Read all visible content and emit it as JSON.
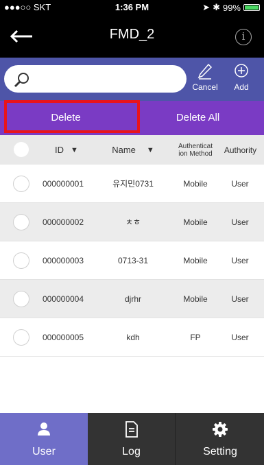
{
  "status_bar": {
    "carrier": "●●●○○ SKT",
    "time": "1:36 PM",
    "battery": "99%"
  },
  "navbar": {
    "title": "FMD_2"
  },
  "search": {
    "placeholder": "",
    "cancel_label": "Cancel",
    "add_label": "Add"
  },
  "actions": {
    "delete_label": "Delete",
    "delete_all_label": "Delete All"
  },
  "table": {
    "headers": {
      "id": "ID",
      "name": "Name",
      "auth_method": "Authenticat ion Method",
      "authority": "Authority"
    },
    "rows": [
      {
        "id": "000000001",
        "name": "유지민0731",
        "auth_method": "Mobile",
        "authority": "User"
      },
      {
        "id": "000000002",
        "name": "ㅊㅎ",
        "auth_method": "Mobile",
        "authority": "User"
      },
      {
        "id": "000000003",
        "name": "0713-31",
        "auth_method": "Mobile",
        "authority": "User"
      },
      {
        "id": "000000004",
        "name": "djrhr",
        "auth_method": "Mobile",
        "authority": "User"
      },
      {
        "id": "000000005",
        "name": "kdh",
        "auth_method": "FP",
        "authority": "User"
      }
    ]
  },
  "tabs": {
    "user_label": "User",
    "log_label": "Log",
    "setting_label": "Setting",
    "active": "User"
  },
  "colors": {
    "search_bar": "#4e55a8",
    "action_bar": "#7a3bc4",
    "active_tab": "#6f6ec8",
    "highlight_box": "#e8141b"
  }
}
